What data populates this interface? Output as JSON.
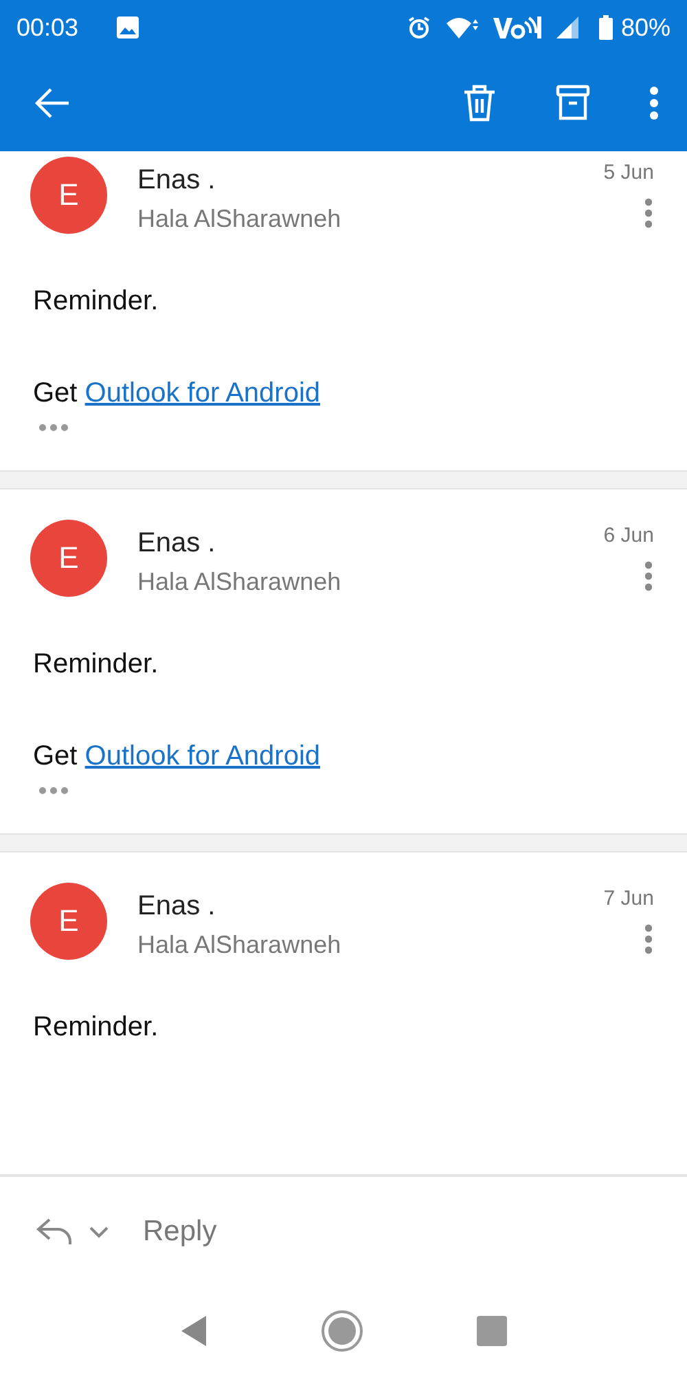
{
  "status_bar": {
    "time": "00:03",
    "battery": "80%"
  },
  "messages": [
    {
      "avatar_letter": "E",
      "color": "#e8453c",
      "sender": "Enas .",
      "recipient": "Hala AlSharawneh",
      "date": "5 Jun",
      "lines": [
        {
          "kind": "text",
          "text": "Reminder."
        },
        {
          "kind": "signature",
          "prefix": "Get",
          "link": "Outlook for Android"
        }
      ],
      "quoted_hidden": true
    },
    {
      "avatar_letter": "E",
      "color": "#e8453c",
      "sender": "Enas .",
      "recipient": "Hala AlSharawneh",
      "date": "6 Jun",
      "lines": [
        {
          "kind": "text",
          "text": "Reminder."
        },
        {
          "kind": "signature",
          "prefix": "Get",
          "link": "Outlook for Android"
        }
      ],
      "quoted_hidden": true
    },
    {
      "avatar_letter": "E",
      "color": "#e8453c",
      "sender": "Enas .",
      "recipient": "Hala AlSharawneh",
      "date": "7 Jun",
      "lines": [
        {
          "kind": "text",
          "text": "Reminder."
        }
      ],
      "quoted_hidden": false
    }
  ],
  "reply_bar": {
    "label": "Reply"
  }
}
